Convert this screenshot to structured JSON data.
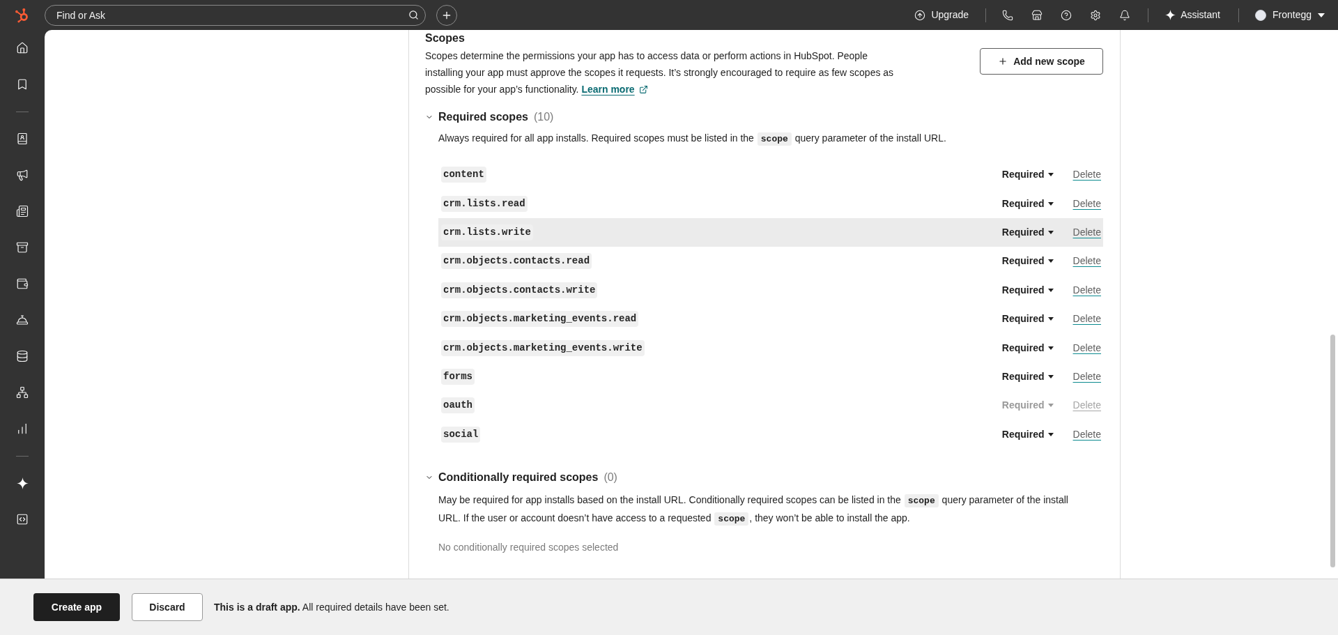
{
  "top_bar": {
    "search": {
      "placeholder": "Find or Ask"
    },
    "upgrade": "Upgrade",
    "assistant": "Assistant",
    "account": {
      "name": "Frontegg"
    }
  },
  "scopes": {
    "title": "Scopes",
    "description": "Scopes determine the permissions your app has to access data or perform actions in HubSpot. People installing your app must approve the scopes it requests. It’s strongly encouraged to require as few scopes as possible for your app’s functionality.",
    "learn_more": "Learn more",
    "add_button": "Add new scope"
  },
  "required_scopes": {
    "title": "Required scopes",
    "count": "(10)",
    "expanded": true,
    "description": [
      {
        "kind": "text",
        "text": "Always required for all app installs. Required scopes must be listed in the "
      },
      {
        "kind": "code",
        "text": "scope"
      },
      {
        "kind": "text",
        "text": " query parameter of the install URL."
      }
    ],
    "rows": [
      {
        "name": "content",
        "requirement": "Required",
        "action": "Delete",
        "disabled": false,
        "highlighted": false
      },
      {
        "name": "crm.lists.read",
        "requirement": "Required",
        "action": "Delete",
        "disabled": false,
        "highlighted": false
      },
      {
        "name": "crm.lists.write",
        "requirement": "Required",
        "action": "Delete",
        "disabled": false,
        "highlighted": true
      },
      {
        "name": "crm.objects.contacts.read",
        "requirement": "Required",
        "action": "Delete",
        "disabled": false,
        "highlighted": false
      },
      {
        "name": "crm.objects.contacts.write",
        "requirement": "Required",
        "action": "Delete",
        "disabled": false,
        "highlighted": false
      },
      {
        "name": "crm.objects.marketing_events.read",
        "requirement": "Required",
        "action": "Delete",
        "disabled": false,
        "highlighted": false
      },
      {
        "name": "crm.objects.marketing_events.write",
        "requirement": "Required",
        "action": "Delete",
        "disabled": false,
        "highlighted": false
      },
      {
        "name": "forms",
        "requirement": "Required",
        "action": "Delete",
        "disabled": false,
        "highlighted": false
      },
      {
        "name": "oauth",
        "requirement": "Required",
        "action": "Delete",
        "disabled": true,
        "highlighted": false
      },
      {
        "name": "social",
        "requirement": "Required",
        "action": "Delete",
        "disabled": false,
        "highlighted": false
      }
    ]
  },
  "conditional_scopes": {
    "title": "Conditionally required scopes",
    "count": "(0)",
    "expanded": true,
    "description": [
      {
        "kind": "text",
        "text": "May be required for app installs based on the install URL. Conditionally required scopes can be listed in the "
      },
      {
        "kind": "code",
        "text": "scope"
      },
      {
        "kind": "text",
        "text": " query parameter of the install URL. If the user or account doesn’t have access to a requested "
      },
      {
        "kind": "code",
        "text": "scope"
      },
      {
        "kind": "text",
        "text": ", they won’t be able to install the app."
      }
    ],
    "empty_text": "No conditionally required scopes selected"
  },
  "footer": {
    "primary_button": "Create app",
    "secondary_button": "Discard",
    "status": "**This is a draft app.** All required details have been set."
  }
}
